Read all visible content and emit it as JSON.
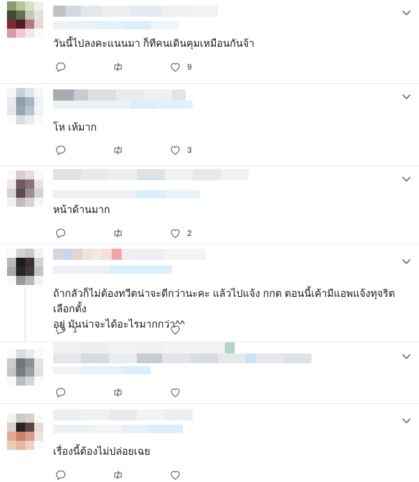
{
  "colors": {
    "icon": "#657786",
    "border": "#e6ecf0",
    "text": "#14171a"
  },
  "tweets": [
    {
      "text": "วันนี้ไปลงคะแนนมา ก็ทีคนเดินคุมเหมือนกันจ้า",
      "reply_count": "",
      "like_count": "9",
      "has_retweet": true
    },
    {
      "text": "โห เห้มาก",
      "reply_count": "",
      "like_count": "3",
      "has_retweet": true
    },
    {
      "text": "หน้าด้านมาก",
      "reply_count": "",
      "like_count": "2",
      "has_retweet": true
    },
    {
      "text": "ถ้ากลัวก็ไม่ต้องทวีตน่าจะดีกว่านะคะ แล้วไปแจ้ง กกต ตอนนี้เค้ามีแอพแจ้งทุจริตเลือกตั้ง\nอยู่ มันน่าจะได้อะไรมากกว่า^^",
      "reply_count": "1",
      "like_count": "",
      "has_retweet": false
    },
    {
      "text": "",
      "reply_count": "",
      "like_count": "",
      "has_retweet": true
    },
    {
      "text": "เรื่องนี้ต้องไม่ปล่อยเฉย",
      "reply_count": "",
      "like_count": "",
      "has_retweet": true
    }
  ],
  "icons": {
    "reply": "reply-icon",
    "retweet": "retweet-icon",
    "like": "heart-icon",
    "menu": "chevron-down-icon"
  }
}
